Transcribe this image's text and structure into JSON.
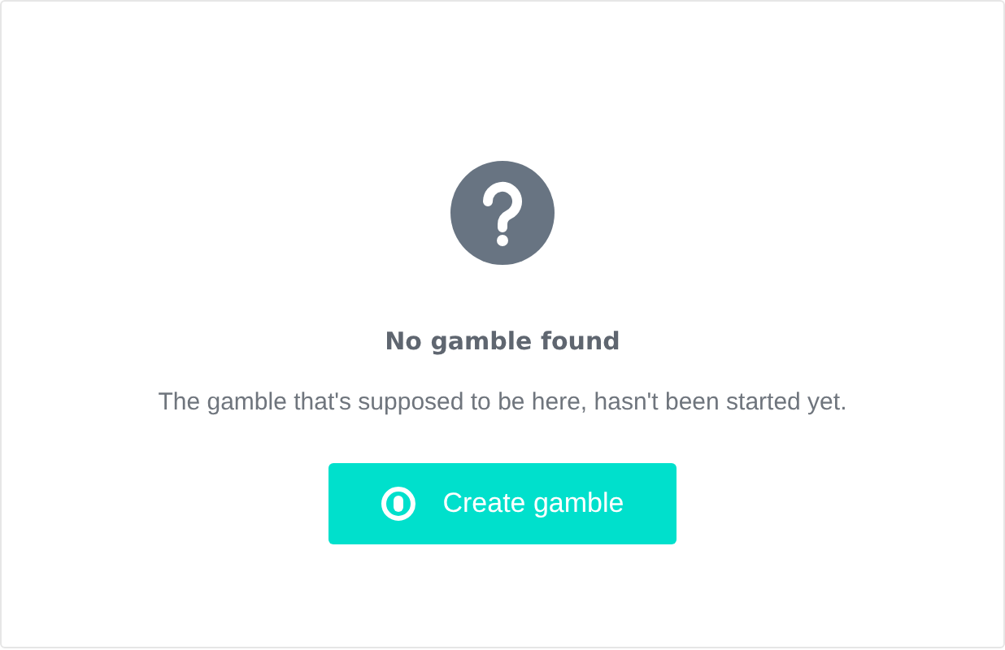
{
  "empty_state": {
    "title": "No gamble found",
    "message": "The gamble that's supposed to be here, hasn't been started yet.",
    "button": {
      "label": "Create gamble"
    }
  }
}
